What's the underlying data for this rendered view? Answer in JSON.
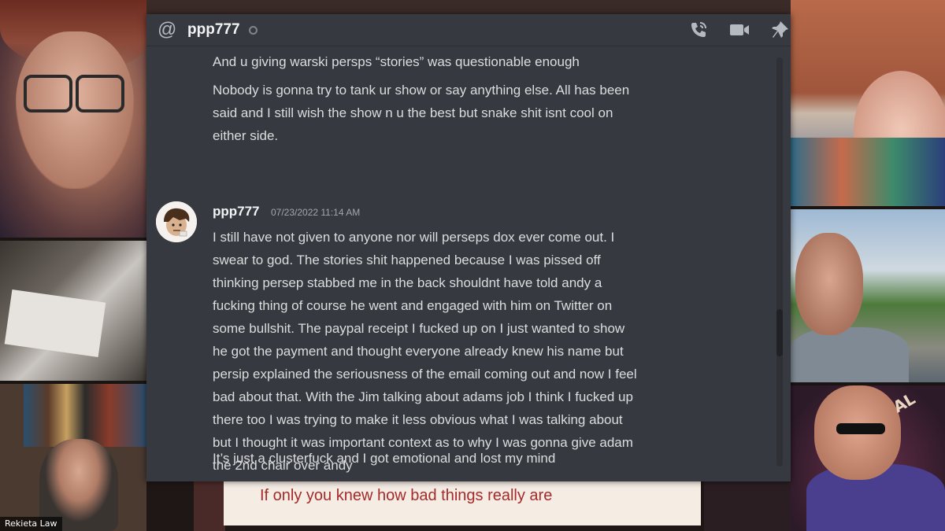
{
  "dm_header": {
    "username": "ppp777",
    "icons": [
      "at-icon",
      "phone-call-icon",
      "video-camera-icon",
      "pin-icon"
    ]
  },
  "messages": {
    "continued_lines": [
      "And u giving warski persps “stories” was questionable enough",
      "Nobody is gonna try to tank ur show or say anything else. All has been",
      "said and I still wish the show n u the best but snake shit isnt cool on",
      "either side."
    ],
    "group": {
      "author": "ppp777",
      "timestamp": "07/23/2022 11:14 AM",
      "lines": [
        "I still have not  given to anyone nor will perseps dox ever come out. I",
        "swear to god. The stories shit happened because I was pissed off",
        "thinking persep stabbed me in the back shouldnt have told andy a",
        "fucking thing of course he went and engaged with him on Twitter on",
        "some bullshit. The paypal receipt I fucked up on I just wanted to show",
        "he got the payment and thought everyone already knew his name but",
        "persip explained the seriousness of the email coming out and now I feel",
        "bad about that. With the Jim talking about adams job I think I fucked up",
        "there too I was trying to make it less obvious what I was talking about",
        "but I thought it was important context as to why I was gonna give adam",
        "the 2nd chair over andy",
        "It’s just a clusterfuck and I got emotional and lost my mind"
      ]
    }
  },
  "video_overlay": {
    "nameplate": "Rekieta Law",
    "caption": "If only you knew how bad things really are",
    "sign_fragment": "AL"
  },
  "colors": {
    "discord_bg": "#36393f",
    "message_text": "#dcddde",
    "caption_text": "#a52a2a",
    "caption_bg": "#f5ece4"
  }
}
